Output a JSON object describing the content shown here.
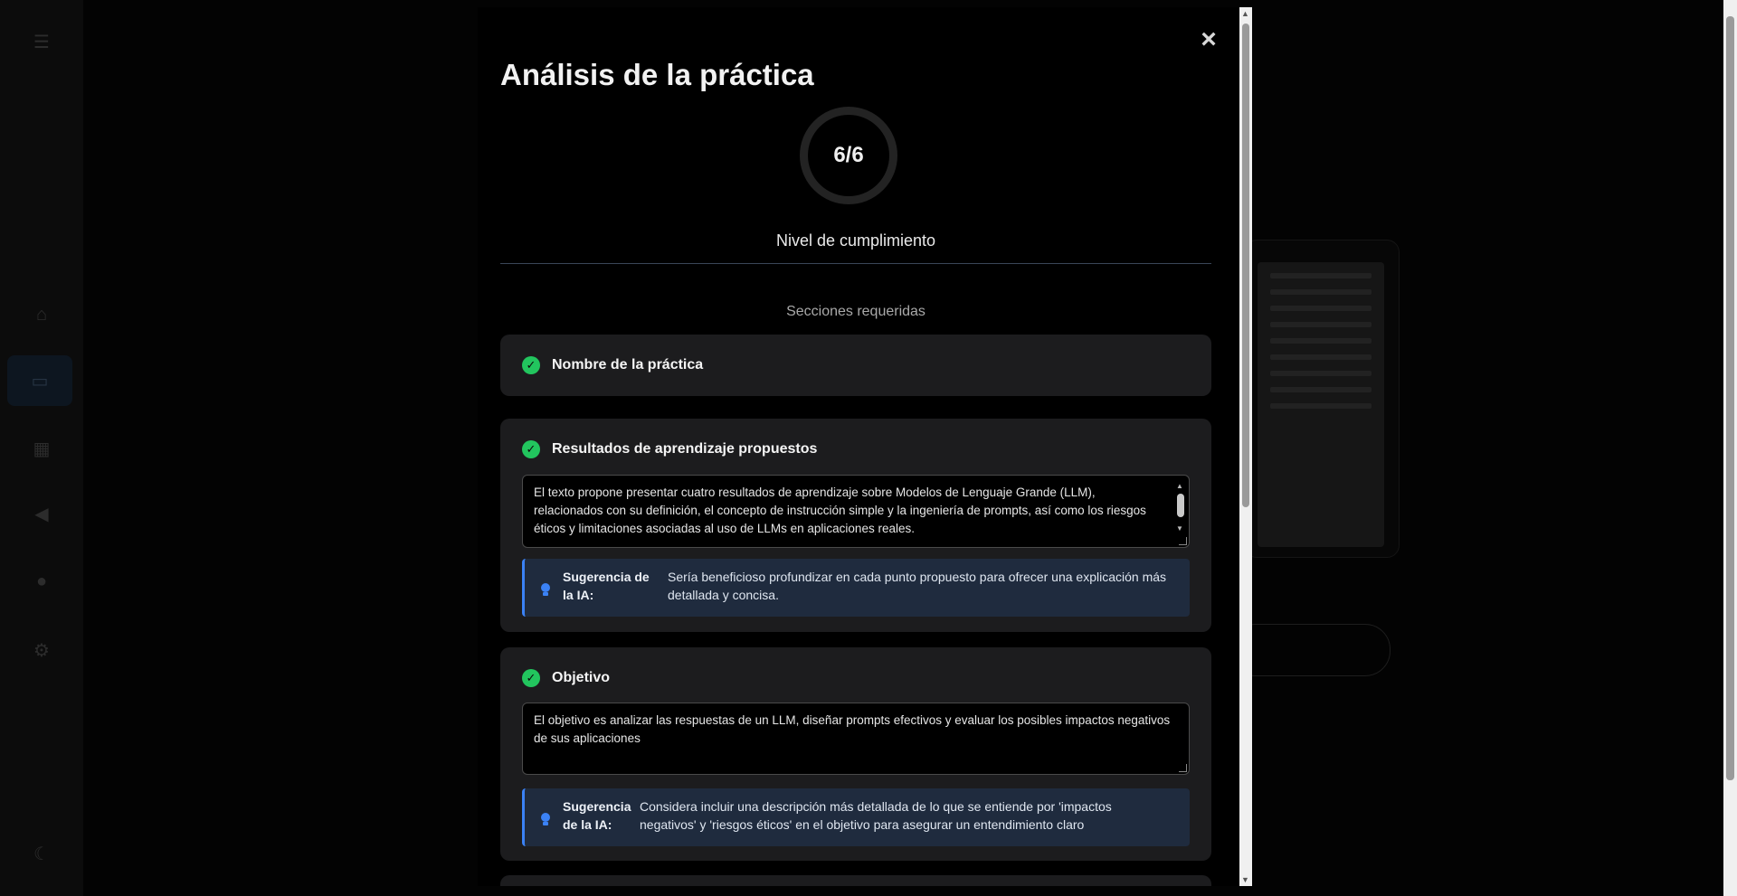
{
  "modal": {
    "title": "Análisis de la práctica",
    "close_symbol": "×",
    "score": "6/6",
    "score_label": "Nivel de cumplimiento",
    "sections_heading": "Secciones requeridas",
    "check_symbol": "✓",
    "suggestion_label_line1": "Sugerencia de",
    "suggestion_label_line2": "la IA:",
    "sections": [
      {
        "title": "Nombre de la práctica"
      },
      {
        "title": "Resultados de aprendizaje propuestos",
        "content": "El texto propone presentar cuatro resultados de aprendizaje sobre Modelos de Lenguaje Grande (LLM), relacionados con su definición, el concepto de instrucción simple y la ingeniería de prompts, así como los riesgos éticos y limitaciones asociadas al uso de LLMs en aplicaciones reales.",
        "suggestion": "Sería beneficioso profundizar en cada punto propuesto para ofrecer una explicación más detallada y concisa."
      },
      {
        "title": "Objetivo",
        "content": "El objetivo es analizar las respuestas de un LLM, diseñar prompts efectivos y evaluar los posibles impactos negativos de sus aplicaciones",
        "suggestion": "Considera incluir una descripción más detallada de lo que se entiende por 'impactos negativos' y 'riesgos éticos' en el objetivo para asegurar un entendimiento claro"
      }
    ]
  },
  "colors": {
    "accent": "#3b82f6",
    "success": "#22c55e",
    "card_bg": "#1c1c1e",
    "suggestion_bg": "#1f2b3e"
  },
  "sidebar_icons": [
    "menu-icon",
    "home-icon",
    "monitor-icon",
    "calendar-icon",
    "megaphone-icon",
    "chat-icon",
    "settings-icon",
    "moon-icon"
  ]
}
